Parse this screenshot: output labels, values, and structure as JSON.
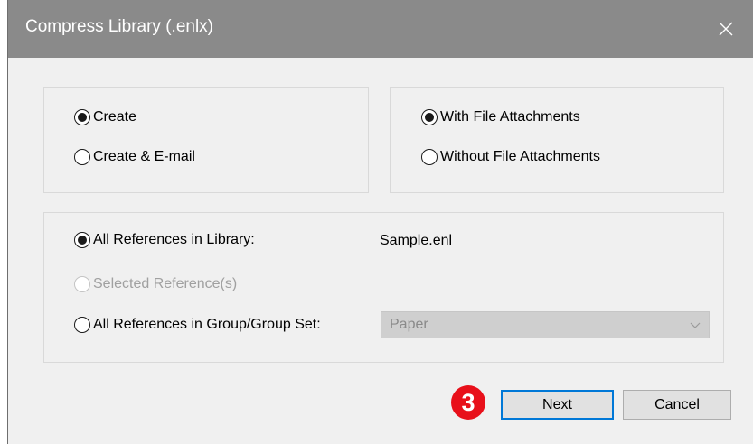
{
  "window": {
    "title": "Compress Library (.enlx)",
    "close_icon": "close-icon"
  },
  "create_group": {
    "options": [
      {
        "label": "Create",
        "checked": true
      },
      {
        "label": "Create & E-mail",
        "checked": false
      }
    ]
  },
  "attachments_group": {
    "options": [
      {
        "label": "With File Attachments",
        "checked": true
      },
      {
        "label": "Without File Attachments",
        "checked": false
      }
    ]
  },
  "references_group": {
    "all_refs": {
      "label": "All References in Library:",
      "checked": true
    },
    "library_name": "Sample.enl",
    "selected_refs": {
      "label": "Selected Reference(s)",
      "checked": false,
      "enabled": false
    },
    "group_refs": {
      "label": "All References in Group/Group Set:",
      "checked": false
    },
    "group_select": {
      "value": "Paper",
      "enabled": false,
      "icon": "chevron-down-icon"
    }
  },
  "buttons": {
    "next": "Next",
    "cancel": "Cancel"
  },
  "annotation": {
    "step_number": "3",
    "color": "#e8101a"
  },
  "colors": {
    "titlebar": "#8a8a8a",
    "dialog_bg": "#f0f0f0",
    "focus_border": "#0078d7"
  }
}
